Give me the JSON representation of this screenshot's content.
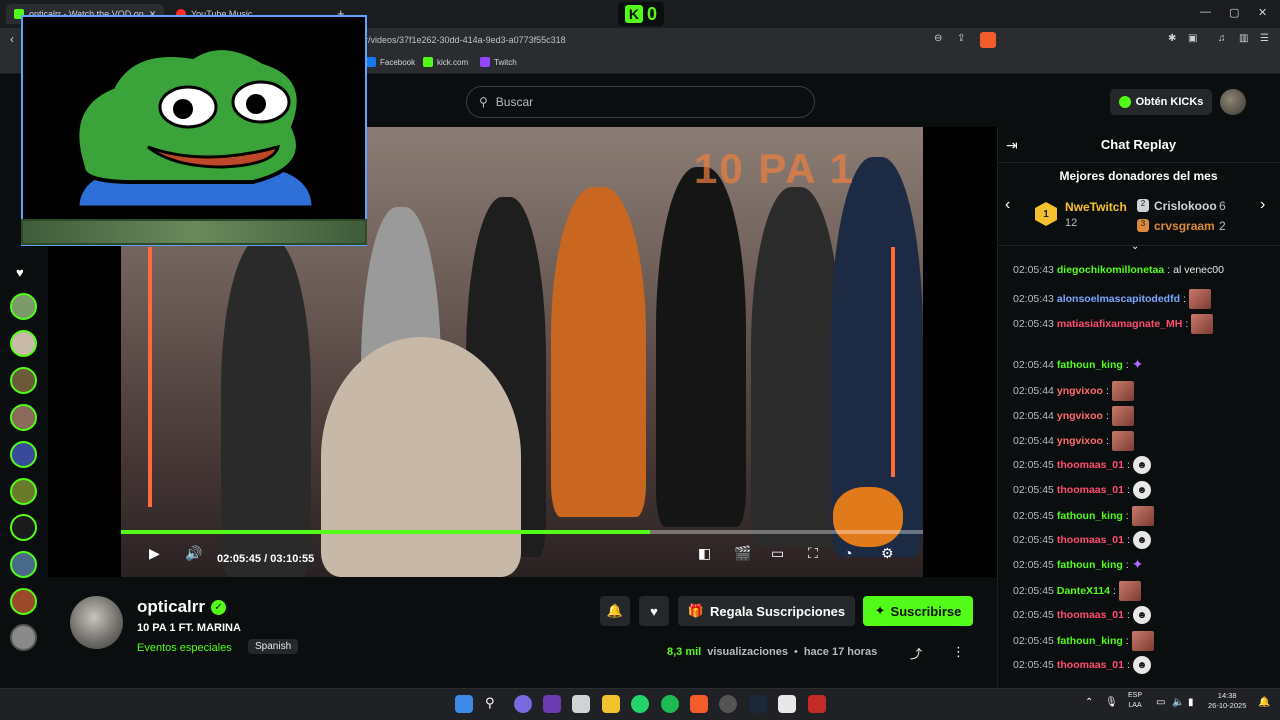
{
  "browser": {
    "tabs": [
      {
        "label": "opticalrr - Watch the VOD on",
        "active": true
      },
      {
        "label": "YouTube Music",
        "active": false
      }
    ],
    "url": "lrr/videos/37f1e262-30dd-414a-9ed3-a0773f55c318",
    "bookmarks": [
      "Facebook",
      "kick.com",
      "Twitch"
    ]
  },
  "kick_counter": {
    "letter": "K",
    "count": "0"
  },
  "header": {
    "search_placeholder": "Buscar",
    "get_kicks_label": "Obtén KICKs"
  },
  "player": {
    "current_time": "02:05:45",
    "separator": "/",
    "duration": "03:10:55",
    "progress": 0.66,
    "overlay_text": "10 PA 1"
  },
  "streamer": {
    "name": "opticalrr",
    "title": "10 PA 1 FT. MARINA",
    "category": "Eventos especiales",
    "language": "Spanish",
    "views_count": "8,3 mil",
    "views_label": "visualizaciones",
    "dot": "•",
    "time_ago": "hace 17 horas"
  },
  "actions": {
    "gift_label": "Regala Suscripciones",
    "subscribe_label": "Suscribirse"
  },
  "chat": {
    "title": "Chat Replay",
    "donors_title": "Mejores donadores del mes",
    "donors": [
      {
        "rank": "1",
        "name": "NweTwitch",
        "count": "12"
      },
      {
        "rank": "2",
        "name": "Crislokooo",
        "count": "6"
      },
      {
        "rank": "3",
        "name": "crvsgraam",
        "count": "2"
      }
    ],
    "messages": [
      {
        "time": "02:05:43",
        "user": "diegochikomillonetaa",
        "color": "#53fc18",
        "text": "al venec00",
        "emote": "none"
      },
      {
        "time": "02:05:43",
        "user": "alonsoelmascapitodedfd",
        "color": "#7ba6ff",
        "text": "",
        "emote": "face"
      },
      {
        "time": "02:05:43",
        "user": "matiasiafixamagnate_MH",
        "color": "#ff4d6d",
        "text": "",
        "emote": "face"
      },
      {
        "time": "02:05:44",
        "user": "fathoun_king",
        "color": "#53fc18",
        "text": "",
        "emote": "feather"
      },
      {
        "time": "02:05:44",
        "user": "yngvixoo",
        "color": "#ff6b6b",
        "text": "",
        "emote": "face"
      },
      {
        "time": "02:05:44",
        "user": "yngvixoo",
        "color": "#ff6b6b",
        "text": "",
        "emote": "face"
      },
      {
        "time": "02:05:44",
        "user": "yngvixoo",
        "color": "#ff6b6b",
        "text": "",
        "emote": "face"
      },
      {
        "time": "02:05:45",
        "user": "thoomaas_01",
        "color": "#ff4d6d",
        "text": "",
        "emote": "ghost"
      },
      {
        "time": "02:05:45",
        "user": "thoomaas_01",
        "color": "#ff4d6d",
        "text": "",
        "emote": "ghost"
      },
      {
        "time": "02:05:45",
        "user": "fathoun_king",
        "color": "#53fc18",
        "text": "",
        "emote": "face"
      },
      {
        "time": "02:05:45",
        "user": "thoomaas_01",
        "color": "#ff4d6d",
        "text": "",
        "emote": "ghost"
      },
      {
        "time": "02:05:45",
        "user": "fathoun_king",
        "color": "#53fc18",
        "text": "",
        "emote": "feather"
      },
      {
        "time": "02:05:45",
        "user": "DanteX114",
        "color": "#53fc18",
        "text": "",
        "emote": "face"
      },
      {
        "time": "02:05:45",
        "user": "thoomaas_01",
        "color": "#ff4d6d",
        "text": "",
        "emote": "ghost"
      },
      {
        "time": "02:05:45",
        "user": "fathoun_king",
        "color": "#53fc18",
        "text": "",
        "emote": "face"
      },
      {
        "time": "02:05:45",
        "user": "thoomaas_01",
        "color": "#ff4d6d",
        "text": "",
        "emote": "ghost"
      }
    ]
  },
  "taskbar": {
    "lang_top": "ESP",
    "lang_bottom": "LAA",
    "time": "14:38",
    "date": "26-10-2025"
  },
  "colors": {
    "accent": "#53fc18",
    "bg": "#0b0e0f",
    "panel": "#24282b"
  }
}
